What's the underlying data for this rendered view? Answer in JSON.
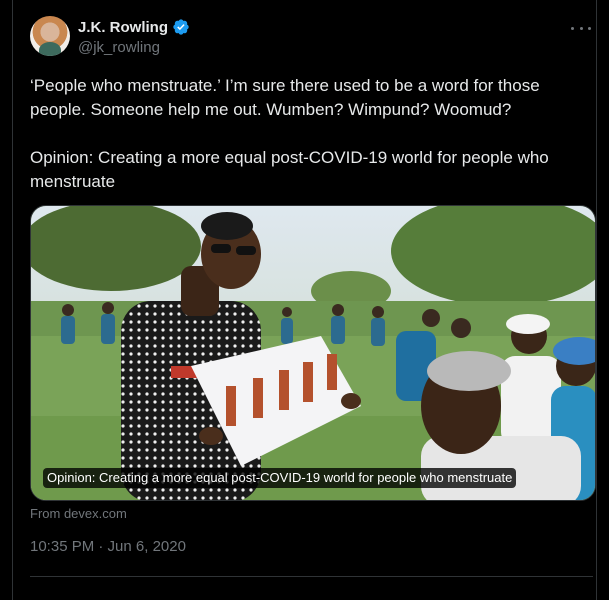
{
  "user": {
    "name": "J.K. Rowling",
    "handle": "@jk_rowling",
    "verified": true,
    "avatar_icon": "profile-avatar"
  },
  "menu_icon": "more-options-icon",
  "tweet": {
    "text": "‘People who menstruate.’ I’m sure there used to be a word for those people. Someone help me out. Wumben? Wimpund? Woomud?\n\nOpinion: Creating a more equal post-COVID-19 world for people who menstruate"
  },
  "card": {
    "image_description_icon": "article-photo",
    "caption": "Opinion: Creating a more equal post-COVID-19 world for people who menstruate",
    "source": "From devex.com"
  },
  "meta": {
    "timestamp": "10:35 PM · Jun 6, 2020"
  },
  "colors": {
    "background": "#000000",
    "text_primary": "#e7e9ea",
    "text_secondary": "#71767b",
    "verified_blue": "#1d9bf0",
    "border": "#2f3336"
  }
}
